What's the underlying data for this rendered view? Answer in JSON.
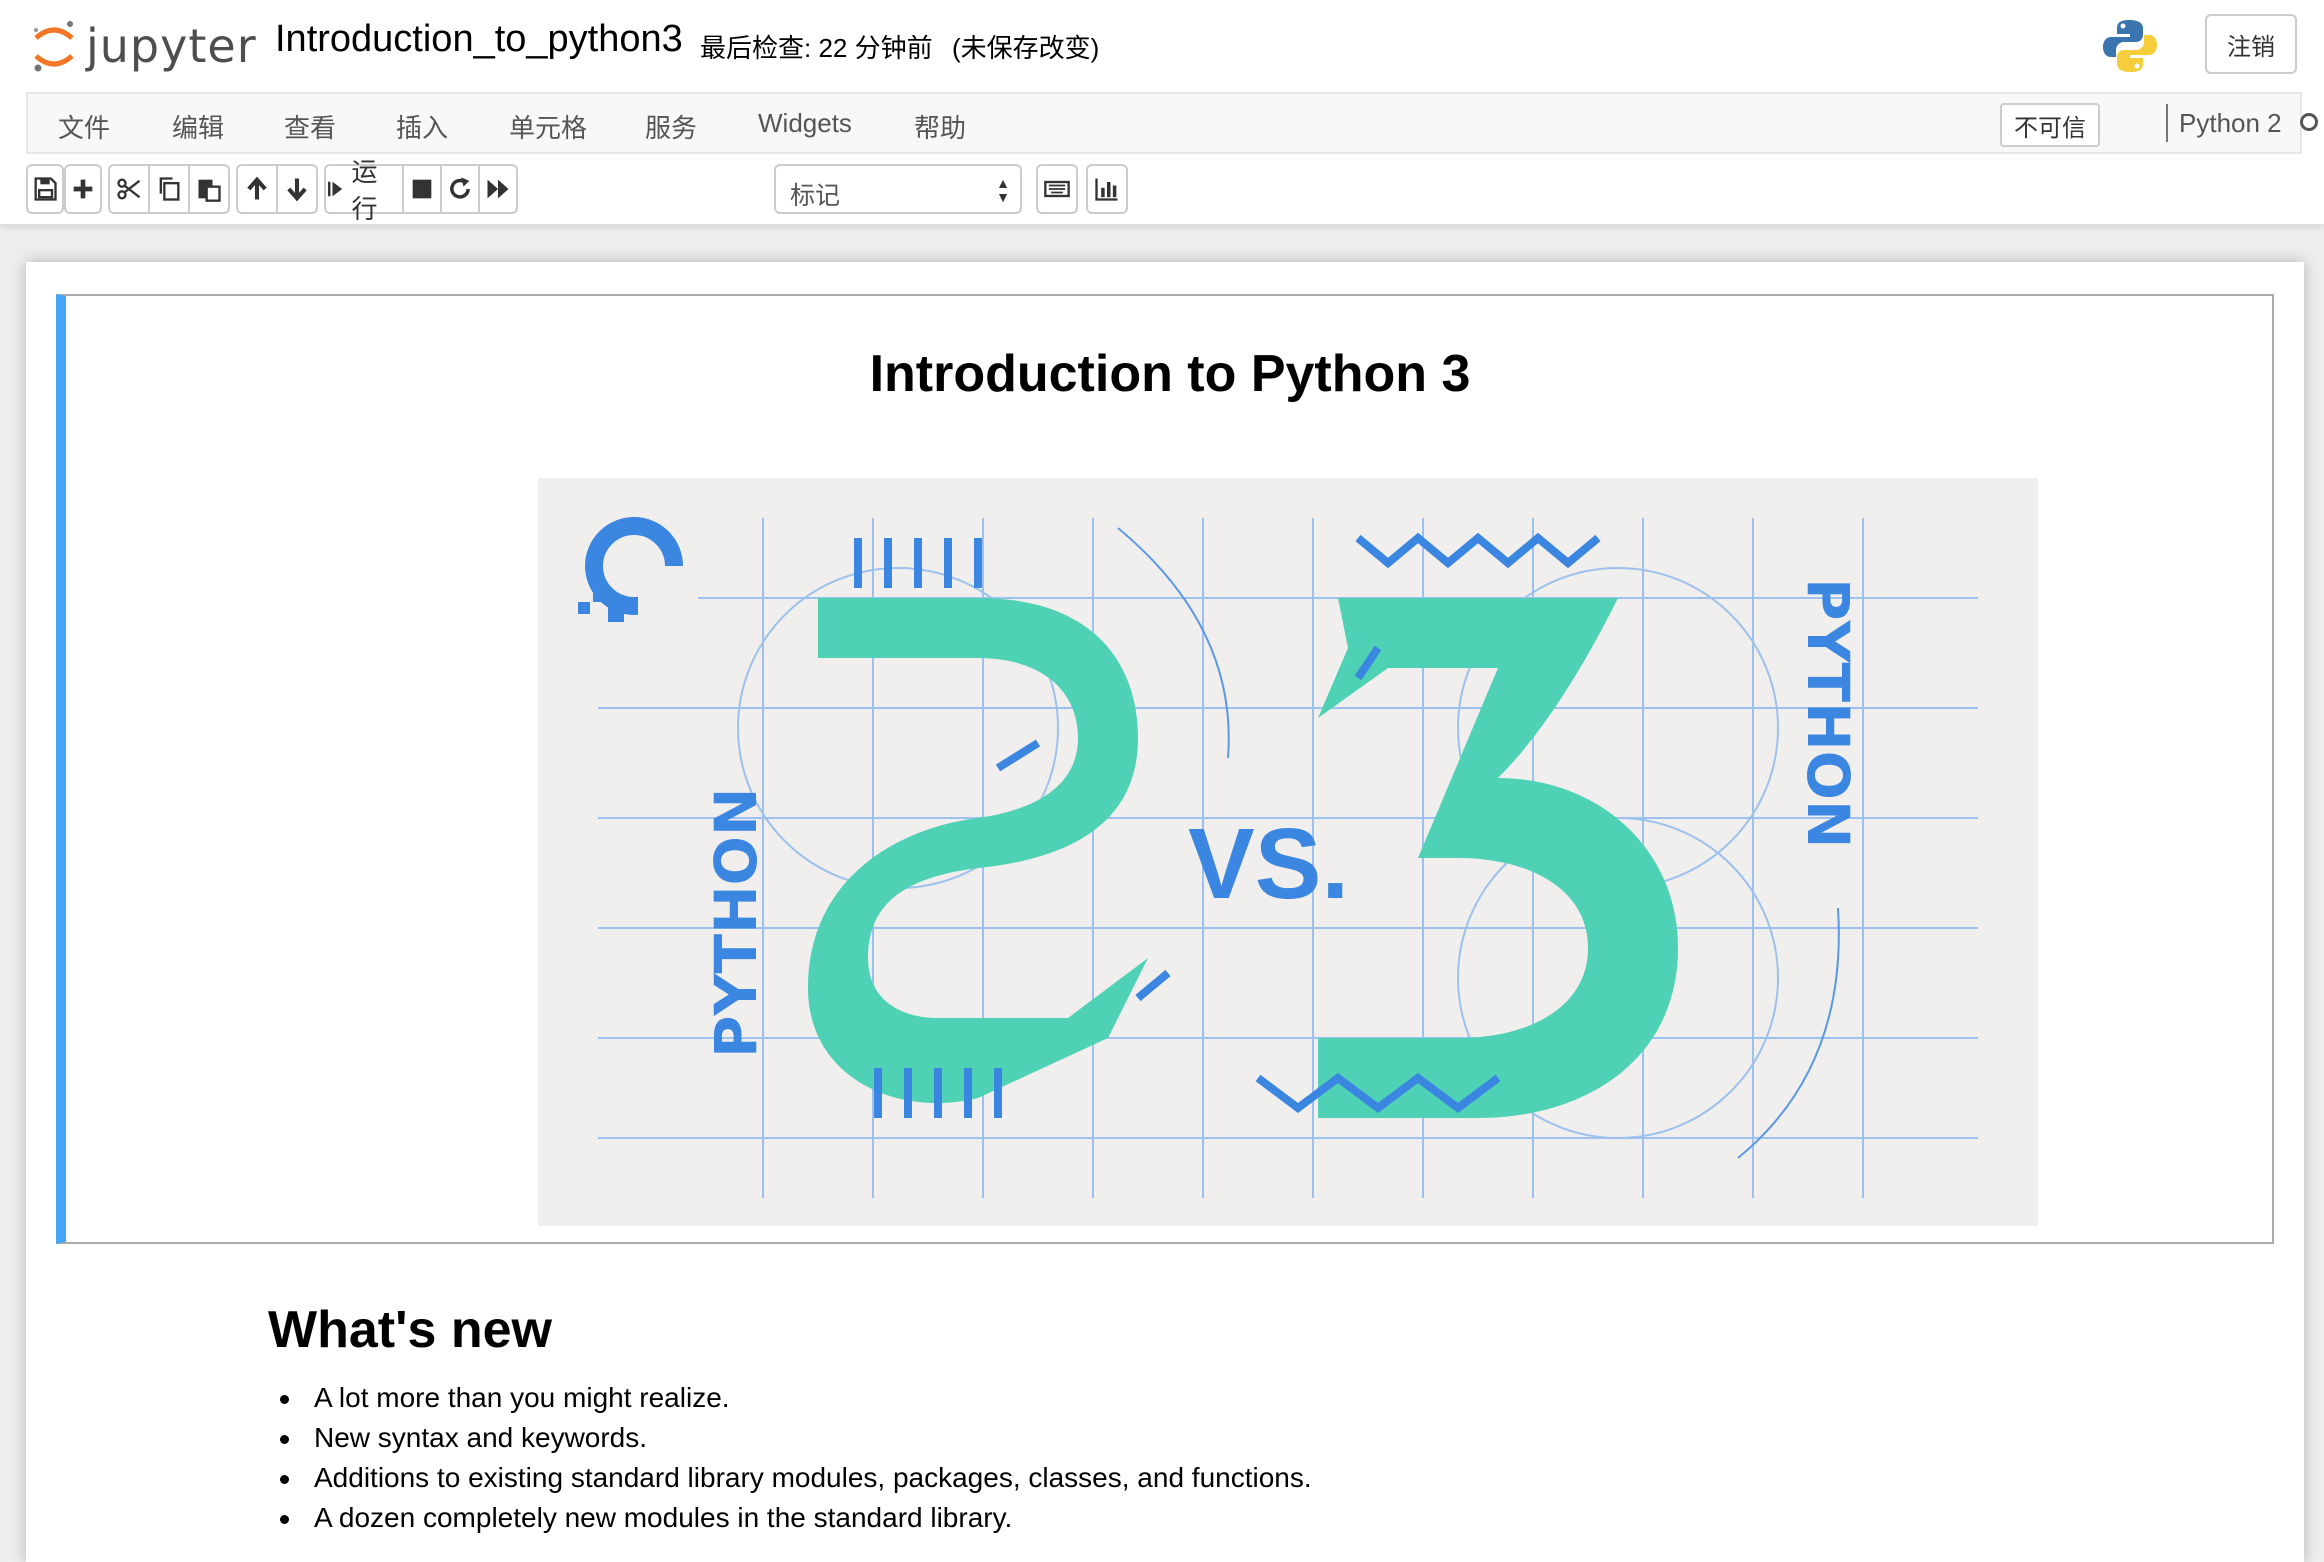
{
  "header": {
    "logo_text": "jupyter",
    "notebook_name": "Introduction_to_python3",
    "checkpoint": "最后检查: 22 分钟前",
    "unsaved": "(未保存改变)",
    "logout_label": "注销"
  },
  "menubar": {
    "items": [
      "文件",
      "编辑",
      "查看",
      "插入",
      "单元格",
      "服务",
      "Widgets",
      "帮助"
    ],
    "trust": "不可信",
    "kernel": "Python 2"
  },
  "toolbar": {
    "run_label": "运行",
    "cell_type": "标记",
    "icons": [
      "save-icon",
      "plus-icon",
      "cut-icon",
      "copy-icon",
      "paste-icon",
      "arrow-up-icon",
      "arrow-down-icon",
      "step-forward-icon",
      "stop-icon",
      "restart-icon",
      "fast-forward-icon",
      "keyboard-icon",
      "bar-chart-icon"
    ]
  },
  "cell1": {
    "title": "Introduction to Python 3",
    "banner": {
      "left_word": "PYTHON",
      "left_digit": "2",
      "middle": "VS.",
      "right_digit": "3",
      "right_word": "PYTHON",
      "colors": {
        "teal": "#4ed1b4",
        "blue": "#3a86e0",
        "bg": "#f1efed"
      }
    }
  },
  "cell2": {
    "heading": "What's new",
    "bullets": [
      "A lot more than you might realize.",
      "New syntax and keywords.",
      "Additions to existing standard library modules, packages, classes, and functions.",
      "A dozen completely new modules in the standard library."
    ]
  }
}
